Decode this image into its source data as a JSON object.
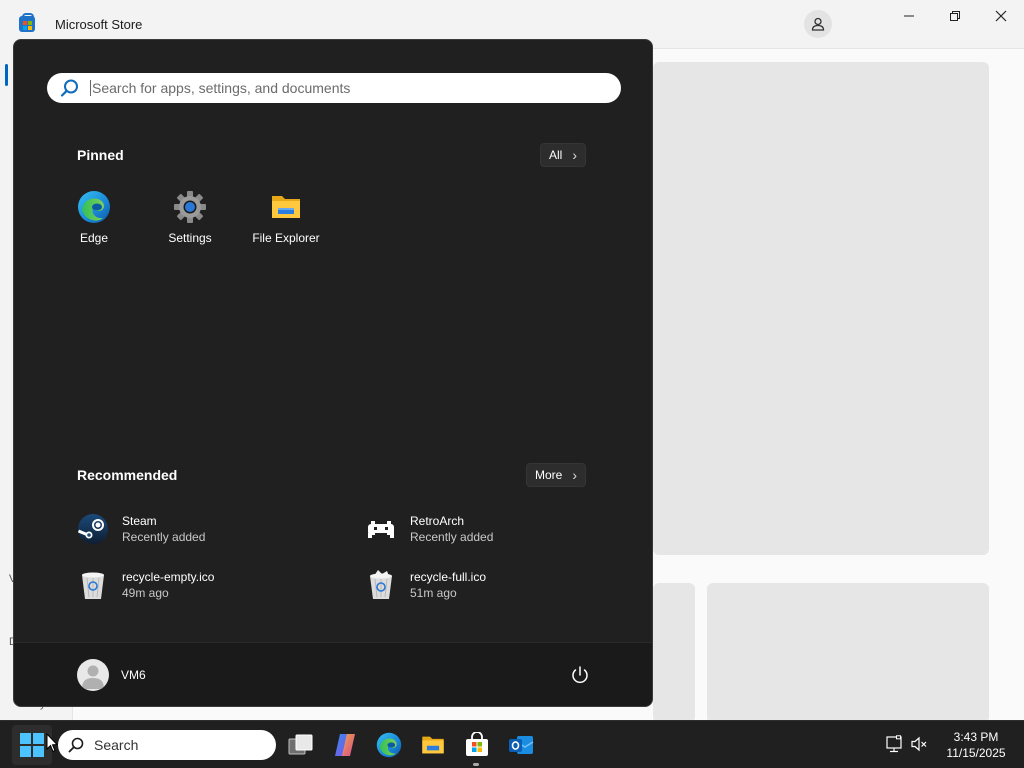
{
  "store_window": {
    "title": "Microsoft Store",
    "sidebar_fragments": [
      "V",
      "D",
      "y"
    ]
  },
  "start_menu": {
    "search_placeholder": "Search for apps, settings, and documents",
    "pinned": {
      "title": "Pinned",
      "all_button": "All",
      "apps": [
        {
          "label": "Edge",
          "icon": "edge-icon"
        },
        {
          "label": "Settings",
          "icon": "settings-gear-icon"
        },
        {
          "label": "File Explorer",
          "icon": "folder-icon"
        }
      ]
    },
    "recommended": {
      "title": "Recommended",
      "more_button": "More",
      "items": [
        {
          "name": "Steam",
          "sub": "Recently added",
          "icon": "steam-icon"
        },
        {
          "name": "RetroArch",
          "sub": "Recently added",
          "icon": "retroarch-icon"
        },
        {
          "name": "recycle-empty.ico",
          "sub": "49m ago",
          "icon": "recycle-bin-empty-icon"
        },
        {
          "name": "recycle-full.ico",
          "sub": "51m ago",
          "icon": "recycle-bin-full-icon"
        }
      ]
    },
    "user": {
      "name": "VM6"
    }
  },
  "taskbar": {
    "search_label": "Search",
    "apps": [
      "task-view-icon",
      "copilot-icon",
      "edge-icon",
      "file-explorer-icon",
      "microsoft-store-icon",
      "outlook-icon"
    ],
    "clock": {
      "time": "3:43 PM",
      "date": "11/15/2025"
    }
  },
  "colors": {
    "start_bg": "#202020",
    "taskbar_bg": "#202020",
    "accent": "#0067c0",
    "search_icon": "#0f6cbd"
  }
}
